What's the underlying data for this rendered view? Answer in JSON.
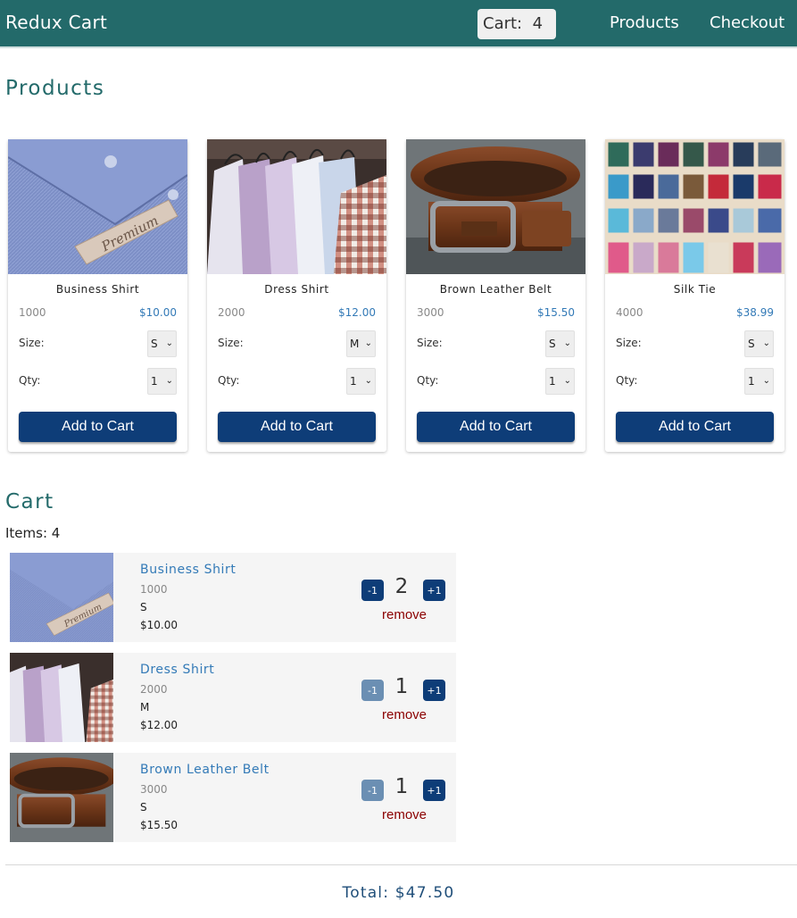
{
  "header": {
    "brand": "Redux Cart",
    "cart_badge": "Cart:  4",
    "nav": [
      "Products",
      "Checkout"
    ],
    "color": "#236a6a"
  },
  "products_title": "Products",
  "products": [
    {
      "name": "Business Shirt",
      "sku": "1000",
      "price": "$10.00",
      "size_label": "Size:",
      "size": "S",
      "qty_label": "Qty:",
      "qty": "1",
      "button": "Add to Cart",
      "image": "business-shirt-photo"
    },
    {
      "name": "Dress Shirt",
      "sku": "2000",
      "price": "$12.00",
      "size_label": "Size:",
      "size": "M",
      "qty_label": "Qty:",
      "qty": "1",
      "button": "Add to Cart",
      "image": "dress-shirts-rack-photo"
    },
    {
      "name": "Brown Leather Belt",
      "sku": "3000",
      "price": "$15.50",
      "size_label": "Size:",
      "size": "S",
      "qty_label": "Qty:",
      "qty": "1",
      "button": "Add to Cart",
      "image": "leather-belt-photo"
    },
    {
      "name": "Silk Tie",
      "sku": "4000",
      "price": "$38.99",
      "size_label": "Size:",
      "size": "S",
      "qty_label": "Qty:",
      "qty": "1",
      "button": "Add to Cart",
      "image": "silk-ties-photo"
    }
  ],
  "cart": {
    "title": "Cart",
    "items_label": "Items: 4",
    "items": [
      {
        "name": "Business Shirt",
        "sku": "1000",
        "size": "S",
        "price": "$10.00",
        "qty": "2",
        "minus": "-1",
        "plus": "+1",
        "remove": "remove",
        "minus_disabled": false
      },
      {
        "name": "Dress Shirt",
        "sku": "2000",
        "size": "M",
        "price": "$12.00",
        "qty": "1",
        "minus": "-1",
        "plus": "+1",
        "remove": "remove",
        "minus_disabled": true
      },
      {
        "name": "Brown Leather Belt",
        "sku": "3000",
        "size": "S",
        "price": "$15.50",
        "qty": "1",
        "minus": "-1",
        "plus": "+1",
        "remove": "remove",
        "minus_disabled": true
      }
    ],
    "total": "Total: $47.50"
  },
  "colors": {
    "primary_button": "#0e3d78",
    "link": "#337ab7",
    "remove": "#8b0000"
  }
}
